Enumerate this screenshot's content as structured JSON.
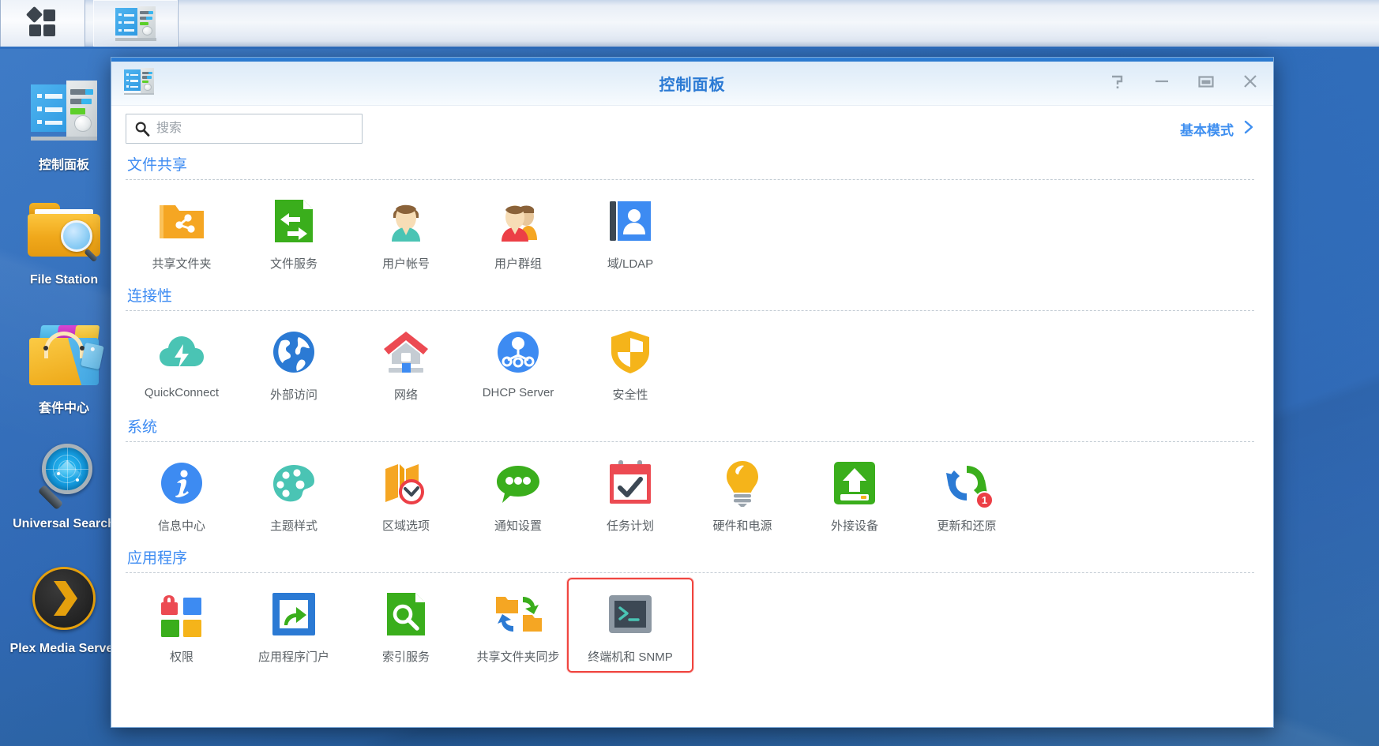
{
  "taskbar": {
    "main_menu_label": "main-menu",
    "items": [
      {
        "name": "menu-button",
        "icon": "grid-icon"
      },
      {
        "name": "control-panel-task",
        "icon": "control-panel-icon",
        "active": true
      }
    ]
  },
  "desktop": {
    "shortcuts": [
      {
        "label": "控制面板",
        "icon": "control-panel-icon"
      },
      {
        "label": "File Station",
        "icon": "file-station-icon"
      },
      {
        "label": "套件中心",
        "icon": "package-center-icon"
      },
      {
        "label": "Universal Search",
        "icon": "universal-search-icon"
      },
      {
        "label": "Plex Media Server",
        "icon": "plex-icon"
      }
    ]
  },
  "window": {
    "title": "控制面板",
    "icon": "control-panel-icon",
    "controls": [
      {
        "name": "help-button",
        "glyph": "?"
      },
      {
        "name": "minimize-button",
        "glyph": "—"
      },
      {
        "name": "maximize-button",
        "glyph": "□"
      },
      {
        "name": "close-button",
        "glyph": "✕"
      }
    ]
  },
  "search": {
    "placeholder": "搜索",
    "value": "",
    "icon": "search-icon"
  },
  "mode_toggle": {
    "label": "基本模式",
    "icon": "chevron-right-icon"
  },
  "sections": [
    {
      "title": "文件共享",
      "tiles": [
        {
          "label": "共享文件夹",
          "icon": "shared-folder-icon"
        },
        {
          "label": "文件服务",
          "icon": "file-services-icon"
        },
        {
          "label": "用户帐号",
          "icon": "user-account-icon"
        },
        {
          "label": "用户群组",
          "icon": "user-group-icon"
        },
        {
          "label": "域/LDAP",
          "icon": "domain-ldap-icon"
        }
      ]
    },
    {
      "title": "连接性",
      "tiles": [
        {
          "label": "QuickConnect",
          "icon": "quickconnect-icon"
        },
        {
          "label": "外部访问",
          "icon": "external-access-icon"
        },
        {
          "label": "网络",
          "icon": "network-icon"
        },
        {
          "label": "DHCP Server",
          "icon": "dhcp-server-icon"
        },
        {
          "label": "安全性",
          "icon": "security-icon"
        }
      ]
    },
    {
      "title": "系统",
      "tiles": [
        {
          "label": "信息中心",
          "icon": "info-center-icon"
        },
        {
          "label": "主题样式",
          "icon": "theme-icon"
        },
        {
          "label": "区域选项",
          "icon": "regional-options-icon"
        },
        {
          "label": "通知设置",
          "icon": "notification-icon"
        },
        {
          "label": "任务计划",
          "icon": "task-scheduler-icon"
        },
        {
          "label": "硬件和电源",
          "icon": "hardware-power-icon"
        },
        {
          "label": "外接设备",
          "icon": "external-devices-icon"
        },
        {
          "label": "更新和还原",
          "icon": "update-restore-icon",
          "badge": "1"
        }
      ]
    },
    {
      "title": "应用程序",
      "tiles": [
        {
          "label": "权限",
          "icon": "privileges-icon"
        },
        {
          "label": "应用程序门户",
          "icon": "application-portal-icon"
        },
        {
          "label": "索引服务",
          "icon": "indexing-service-icon"
        },
        {
          "label": "共享文件夹同步",
          "icon": "shared-folder-sync-icon"
        },
        {
          "label": "终端机和 SNMP",
          "icon": "terminal-snmp-icon",
          "selected": true
        }
      ]
    }
  ],
  "colors": {
    "accent_blue": "#3d8bf2",
    "title_blue": "#2b7ad4",
    "selection_red": "#f0453f",
    "desktop_blue": "#2d6cbd",
    "label_gray": "#5b6166",
    "orange": "#f5a623",
    "green": "#3aae1c",
    "teal": "#4ac4b4"
  }
}
